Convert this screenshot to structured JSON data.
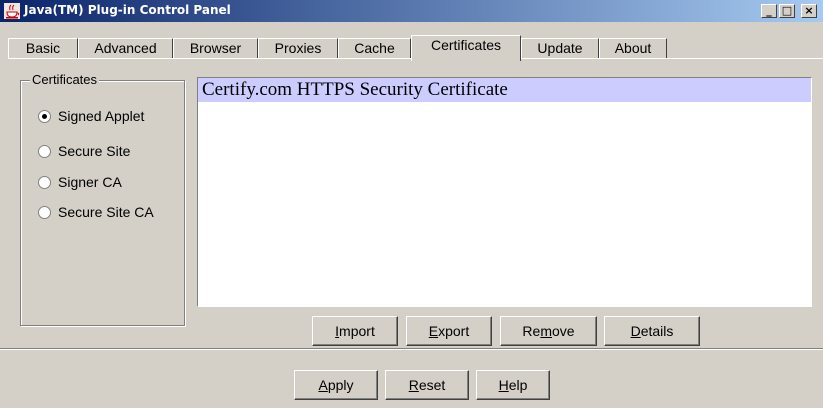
{
  "window": {
    "title": "Java(TM) Plug-in Control Panel",
    "icon": "java-cup-icon",
    "minimize": "_",
    "maximize": "□",
    "close": "×"
  },
  "tabs": [
    {
      "label": "Basic"
    },
    {
      "label": "Advanced"
    },
    {
      "label": "Browser"
    },
    {
      "label": "Proxies"
    },
    {
      "label": "Cache"
    },
    {
      "label": "Certificates",
      "active": true
    },
    {
      "label": "Update"
    },
    {
      "label": "About"
    }
  ],
  "certificates": {
    "group_title": "Certificates",
    "options": [
      {
        "label": "Signed Applet",
        "selected": true
      },
      {
        "label": "Secure Site",
        "selected": false
      },
      {
        "label": "Signer CA",
        "selected": false
      },
      {
        "label": "Secure Site CA",
        "selected": false
      }
    ],
    "list": [
      "Certify.com HTTPS Security Certificate"
    ],
    "buttons": {
      "import": {
        "mnemonic": "I",
        "rest": "mport"
      },
      "export": {
        "mnemonic": "E",
        "rest": "xport"
      },
      "remove": {
        "before": "Re",
        "mnemonic": "m",
        "rest": "ove"
      },
      "details": {
        "mnemonic": "D",
        "rest": "etails"
      }
    }
  },
  "footer": {
    "apply": {
      "mnemonic": "A",
      "rest": "pply"
    },
    "reset": {
      "mnemonic": "R",
      "rest": "eset"
    },
    "help": {
      "mnemonic": "H",
      "rest": "elp"
    }
  },
  "colors": {
    "titlebar_start": "#0a246a",
    "titlebar_end": "#a6caf0",
    "face": "#d4d0c8",
    "selection": "#ccccff"
  }
}
